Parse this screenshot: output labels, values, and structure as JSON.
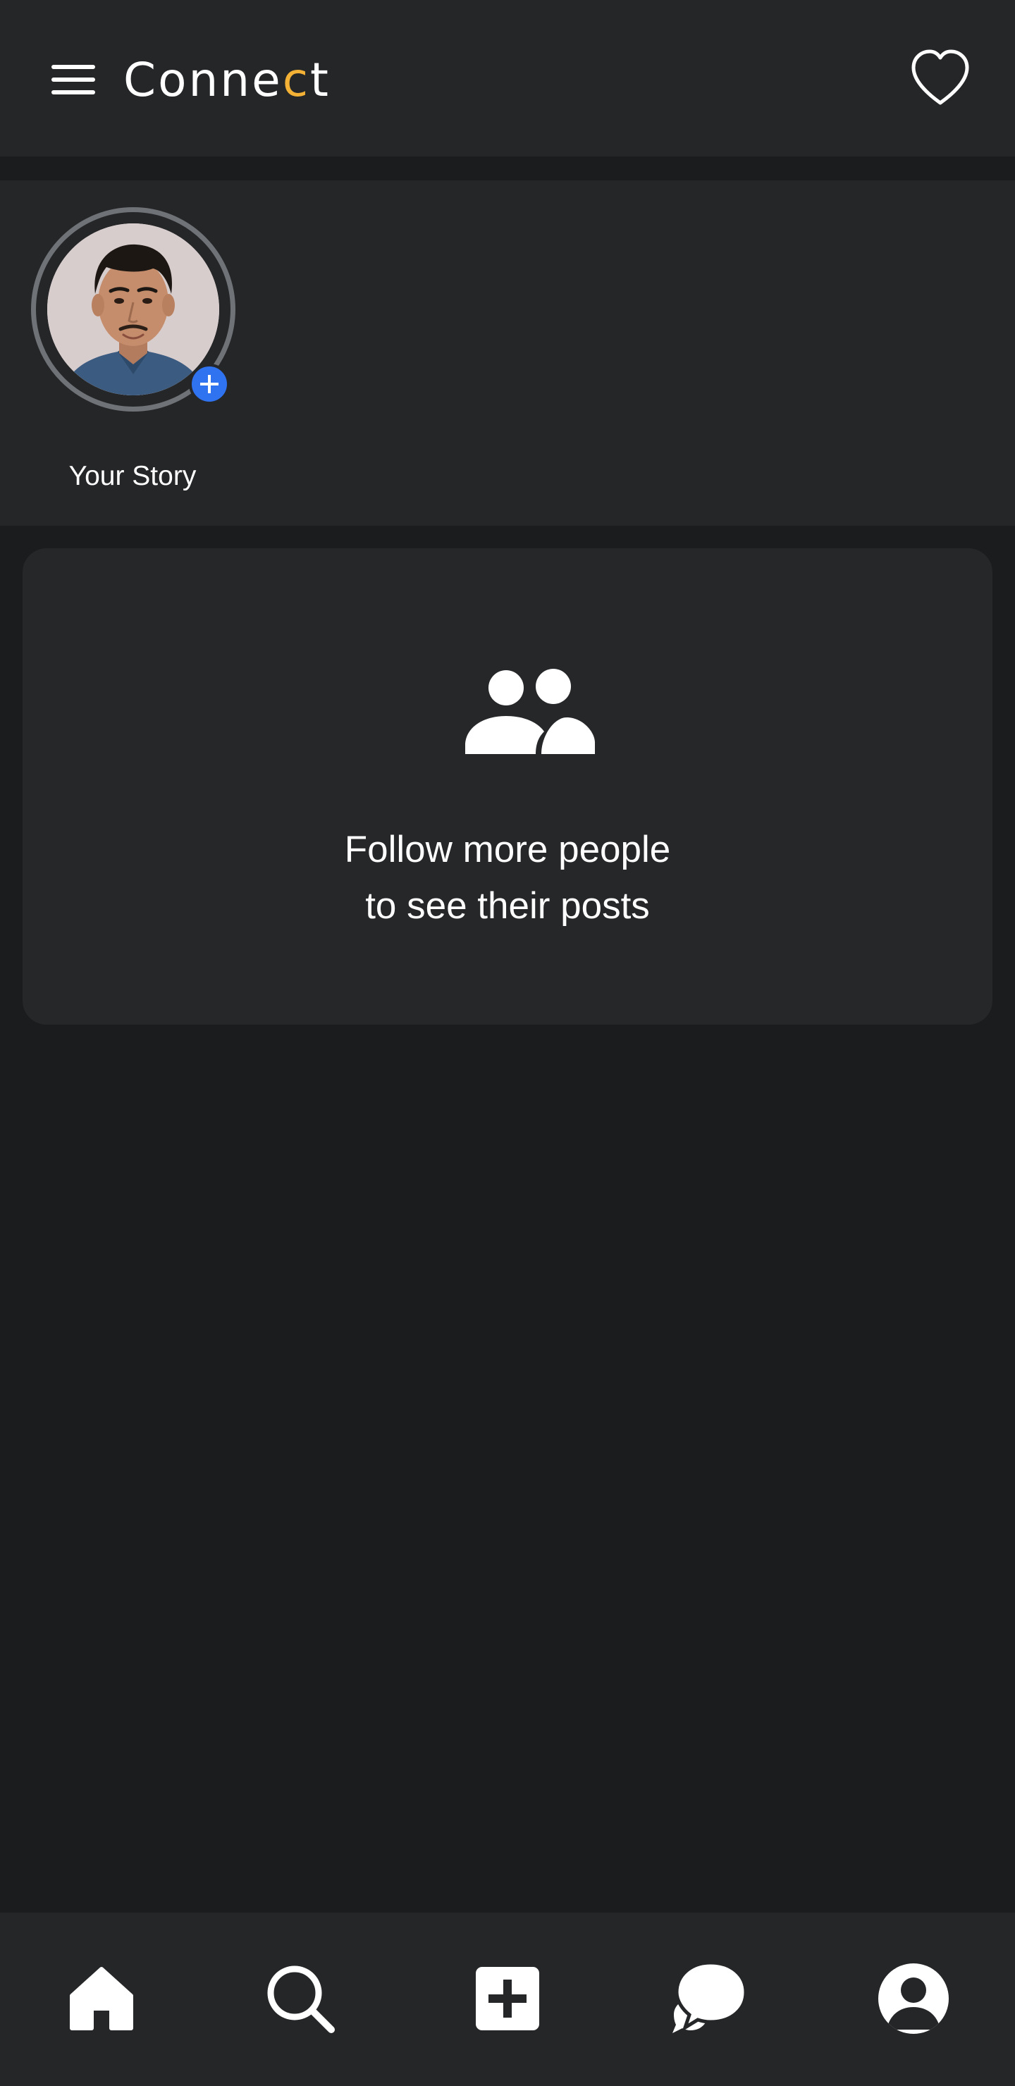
{
  "header": {
    "logo_prefix": "Conne",
    "logo_accent": "c",
    "logo_suffix": "t",
    "menu_icon": "hamburger-menu-icon",
    "activity_icon": "heart-outline-icon"
  },
  "stories": {
    "items": [
      {
        "label": "Your Story",
        "icon": "add-plus-icon"
      }
    ]
  },
  "feed": {
    "empty_line1": "Follow more people",
    "empty_line2": "to see their posts",
    "empty_icon": "people-group-icon"
  },
  "bottom_nav": {
    "items": [
      {
        "icon": "home-icon"
      },
      {
        "icon": "search-icon"
      },
      {
        "icon": "add-post-icon"
      },
      {
        "icon": "chat-icon"
      },
      {
        "icon": "profile-icon"
      }
    ]
  },
  "colors": {
    "background": "#1b1c1e",
    "surface": "#252628",
    "accent": "#f3b236",
    "badge": "#2f73f0",
    "text": "#ffffff"
  }
}
